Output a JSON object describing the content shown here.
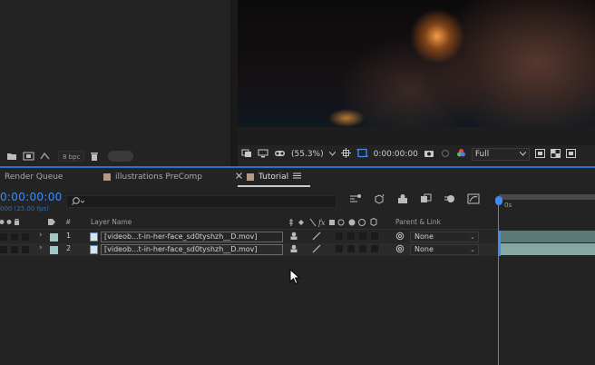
{
  "project_toolbar": {
    "bpc": "8 bpc"
  },
  "viewer_toolbar": {
    "zoom": "(55.3%)",
    "timecode": "0:00:00:00",
    "resolution": "Full"
  },
  "tabs": [
    {
      "label": "Render Queue",
      "active": false
    },
    {
      "label": "illustrations PreComp",
      "active": false
    },
    {
      "label": "Tutorial",
      "active": true
    }
  ],
  "timeline": {
    "timecode": "0:00:00:00",
    "fps": "000 (25.00 fps)",
    "headers": {
      "num": "#",
      "layer_name": "Layer Name",
      "parent": "Parent & Link"
    },
    "layers": [
      {
        "num": "1",
        "name": "[videob...t-in-her-face_sd0tyshzh__D.mov]",
        "parent": "None"
      },
      {
        "num": "2",
        "name": "[videob...t-in-her-face_sd0tyshzh__D.mov]",
        "parent": "None"
      }
    ],
    "ruler_label": "0s",
    "layer_color": "#9dc8c3",
    "accent_color": "#3e8bf5"
  }
}
